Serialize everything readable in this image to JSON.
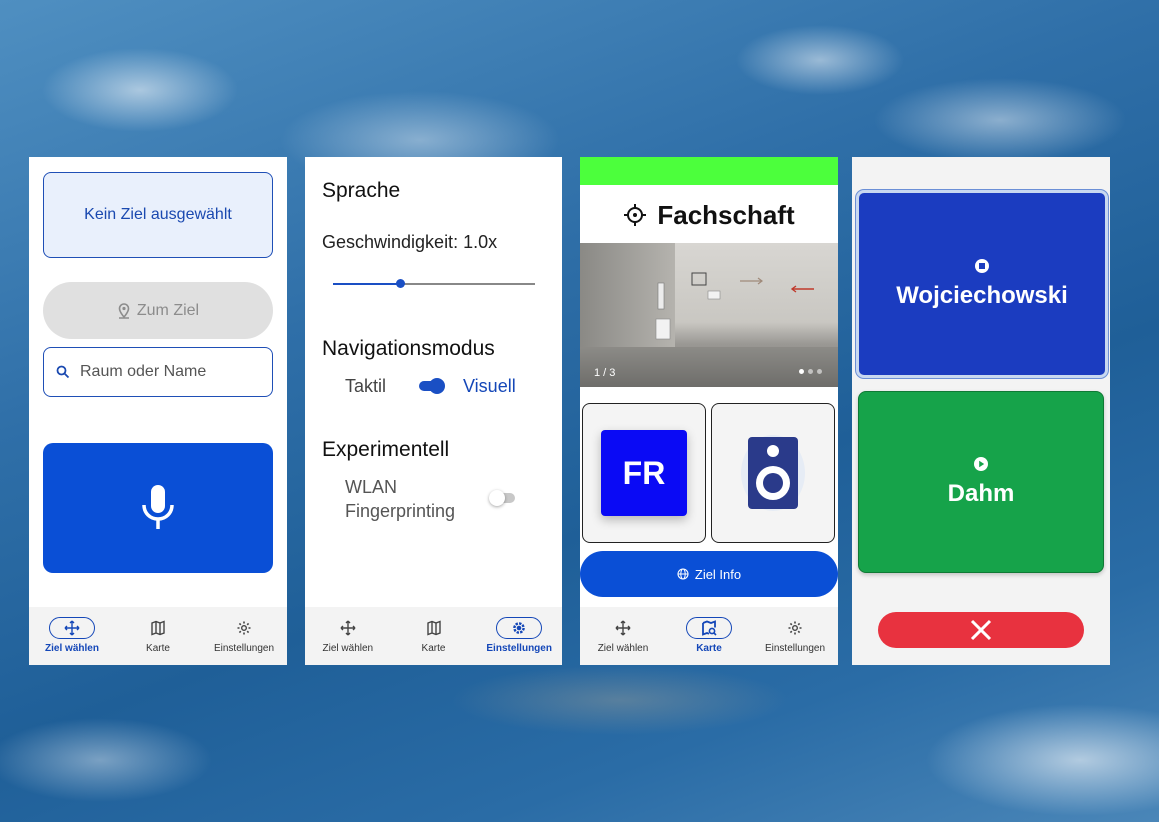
{
  "nav": {
    "items": [
      {
        "label": "Ziel wählen",
        "icon": "move-icon"
      },
      {
        "label": "Karte",
        "icon": "map-icon"
      },
      {
        "label": "Einstellungen",
        "icon": "gear-icon"
      }
    ]
  },
  "screen1": {
    "no_target": "Kein Ziel ausgewählt",
    "goto_label": "Zum Ziel",
    "search_placeholder": "Raum oder Name",
    "mic_icon": "microphone-icon",
    "active_tab": "Ziel wählen"
  },
  "screen2": {
    "language_heading": "Sprache",
    "speed_label": "Geschwindigkeit: 1.0x",
    "speed_fraction": 0.33,
    "navmode_heading": "Navigationsmodus",
    "navmode_left": "Taktil",
    "navmode_right": "Visuell",
    "navmode_on": true,
    "experimental_heading": "Experimentell",
    "wlan_line1": "WLAN",
    "wlan_line2": "Fingerprinting",
    "wlan_on": false,
    "active_tab": "Einstellungen"
  },
  "screen3": {
    "room_title": "Fachschaft",
    "photo_counter": "1 / 3",
    "fr_label": "FR",
    "info_label": "Ziel Info",
    "active_tab": "Karte"
  },
  "screen4": {
    "card1_label": "Wojciechowski",
    "card2_label": "Dahm"
  },
  "colors": {
    "primary": "#0a4fd6",
    "green_bar": "#4cff3c",
    "card_blue": "#1b3cc0",
    "card_green": "#16a34a",
    "close_red": "#e8323f"
  }
}
